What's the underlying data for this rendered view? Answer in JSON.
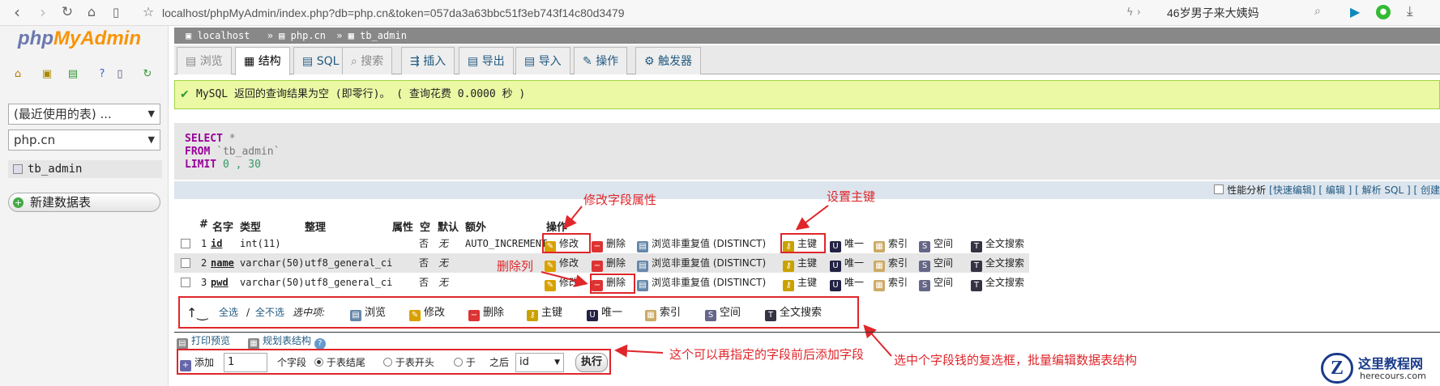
{
  "browser": {
    "url": "localhost/phpMyAdmin/index.php?db=php.cn&token=057da3a63bbc51f3eb743f14c80d3479",
    "search_text": "46岁男子来大姨妈"
  },
  "sidebar": {
    "logo_php": "php",
    "logo_my": "MyAdmin",
    "recent_select": "(最近使用的表) ...",
    "db_select": "php.cn",
    "table_item": "tb_admin",
    "new_db_button": "新建数据表"
  },
  "breadcrumb": {
    "server": "localhost",
    "db": "php.cn",
    "table": "tb_admin"
  },
  "tabs": [
    {
      "label": "浏览",
      "icon": "browse-icon"
    },
    {
      "label": "结构",
      "icon": "structure-icon"
    },
    {
      "label": "SQL",
      "icon": "sql-icon"
    },
    {
      "label": "搜索",
      "icon": "search-icon"
    },
    {
      "label": "插入",
      "icon": "insert-icon"
    },
    {
      "label": "导出",
      "icon": "export-icon"
    },
    {
      "label": "导入",
      "icon": "import-icon"
    },
    {
      "label": "操作",
      "icon": "wrench-icon"
    },
    {
      "label": "触发器",
      "icon": "trigger-icon"
    }
  ],
  "message": "MySQL 返回的查询结果为空 (即零行)。 ( 查询花费 0.0000 秒 )",
  "sql": {
    "select": "SELECT",
    "star": "*",
    "from": "FROM",
    "table": "`tb_admin`",
    "limit": "LIMIT",
    "limit_val": "0 , 30"
  },
  "tools": {
    "profiling": "性能分析",
    "links": "[快速编辑] [ 编辑 ] [ 解析 SQL ] [ 创建"
  },
  "table": {
    "headers": [
      "#",
      "名字",
      "类型",
      "整理",
      "属性",
      "空",
      "默认",
      "额外",
      "操作"
    ],
    "rows": [
      {
        "num": "1",
        "name": "id",
        "type": "int(11)",
        "collation": "",
        "null": "否",
        "default": "无",
        "extra": "AUTO_INCREMENT"
      },
      {
        "num": "2",
        "name": "name",
        "type": "varchar(50)",
        "collation": "utf8_general_ci",
        "null": "否",
        "default": "无",
        "extra": ""
      },
      {
        "num": "3",
        "name": "pwd",
        "type": "varchar(50)",
        "collation": "utf8_general_ci",
        "null": "否",
        "default": "无",
        "extra": ""
      }
    ],
    "actions": [
      "修改",
      "删除",
      "浏览非重复值 (DISTINCT)",
      "主键",
      "唯一",
      "索引",
      "空间",
      "全文搜索"
    ]
  },
  "bulk": {
    "select_all": "全选",
    "sep": "/",
    "deselect_all": "全不选",
    "selected": "选中项:",
    "actions": [
      "浏览",
      "修改",
      "删除",
      "主键",
      "唯一",
      "索引",
      "空间",
      "全文搜索"
    ]
  },
  "print": {
    "print_preview": "打印预览",
    "plan": "规划表结构"
  },
  "addfield": {
    "label": "添加",
    "count": "1",
    "unit": "个字段",
    "opt_end": "于表结尾",
    "opt_start": "于表开头",
    "opt_after_a": "于",
    "opt_after_b": "之后",
    "after_select": "id",
    "execute": "执行"
  },
  "annotations": {
    "edit": "修改字段属性",
    "primary": "设置主键",
    "delete": "删除列",
    "add": "这个可以再指定的字段前后添加字段",
    "bulk": "选中个字段钱的复选框，批量编辑数据表结构"
  },
  "watermark": {
    "title": "这里教程网",
    "sub": "herecours.com"
  },
  "colors": {
    "annotation": "#e0262b",
    "link": "#235a81",
    "success": "#ebf8a4"
  }
}
